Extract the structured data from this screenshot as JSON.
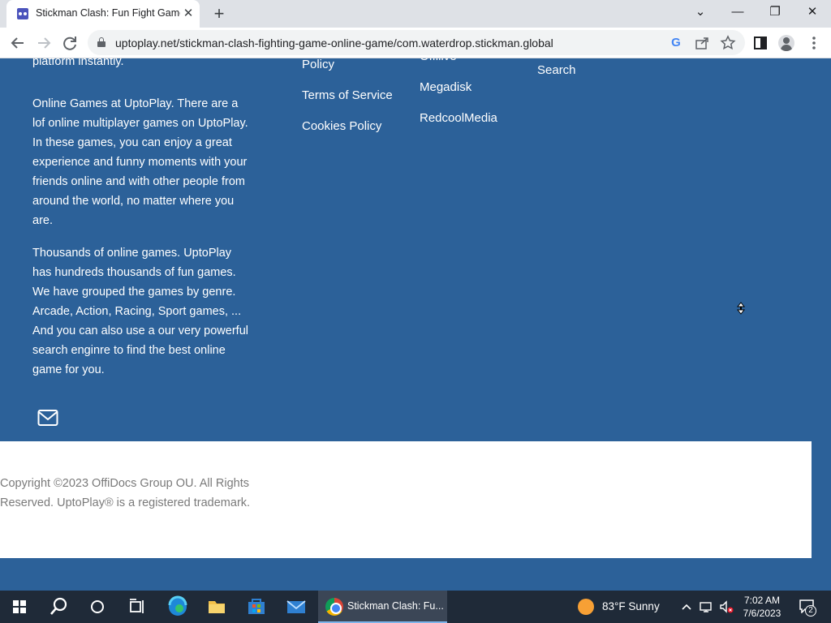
{
  "browser": {
    "tab_title": "Stickman Clash: Fun Fight Game",
    "tab_close": "✕",
    "new_tab": "+",
    "url": "uptoplay.net/stickman-clash-fighting-game-online-game/com.waterdrop.stickman.global",
    "window_controls": {
      "dropdown": "⌄",
      "minimize": "—",
      "restore": "❐",
      "close": "✕"
    }
  },
  "footer": {
    "about_paragraphs": [
      "platform instantly.",
      "Online Games at UptoPlay. There are a lof online multiplayer games on UptoPlay. In these games, you can enjoy a great experience and funny moments with your friends online and with other people from around the world, no matter where you are.",
      "Thousands of online games. UptoPlay has hundreds thousands of fun games. We have grouped the games by genre. Arcade, Action, Racing, Sport games, ... And you can also use a our very powerful search enginre to find the best online game for you."
    ],
    "legal_links": [
      "Policy",
      "Terms of Service",
      "Cookies Policy"
    ],
    "partner_links": [
      "Offilive",
      "Megadisk",
      "RedcoolMedia"
    ],
    "tools_links": [
      "Search"
    ],
    "copyright": "Copyright ©2023 OffiDocs Group OU. All Rights Reserved. UptoPlay® is a registered trademark."
  },
  "taskbar": {
    "active_window_title": "Stickman Clash: Fu...",
    "weather": "83°F  Sunny",
    "time": "7:02 AM",
    "date": "7/6/2023",
    "notification_count": "2"
  },
  "colors": {
    "footer_bg": "#2c6199",
    "copyright_bg": "#ffffff",
    "taskbar_bg": "#1f2a38",
    "accent": "#7eb4ea"
  },
  "icons": [
    "back-icon",
    "forward-icon",
    "reload-icon",
    "lock-icon",
    "google-icon",
    "share-icon",
    "star-icon",
    "side-panel-icon",
    "profile-icon",
    "menu-icon",
    "mail-icon",
    "windows-start-icon",
    "search-icon",
    "cortana-icon",
    "task-view-icon",
    "edge-icon",
    "file-explorer-icon",
    "store-icon",
    "mail-app-icon",
    "chrome-icon",
    "sun-icon",
    "chevron-up-icon",
    "network-icon",
    "volume-muted-icon",
    "notification-icon"
  ]
}
